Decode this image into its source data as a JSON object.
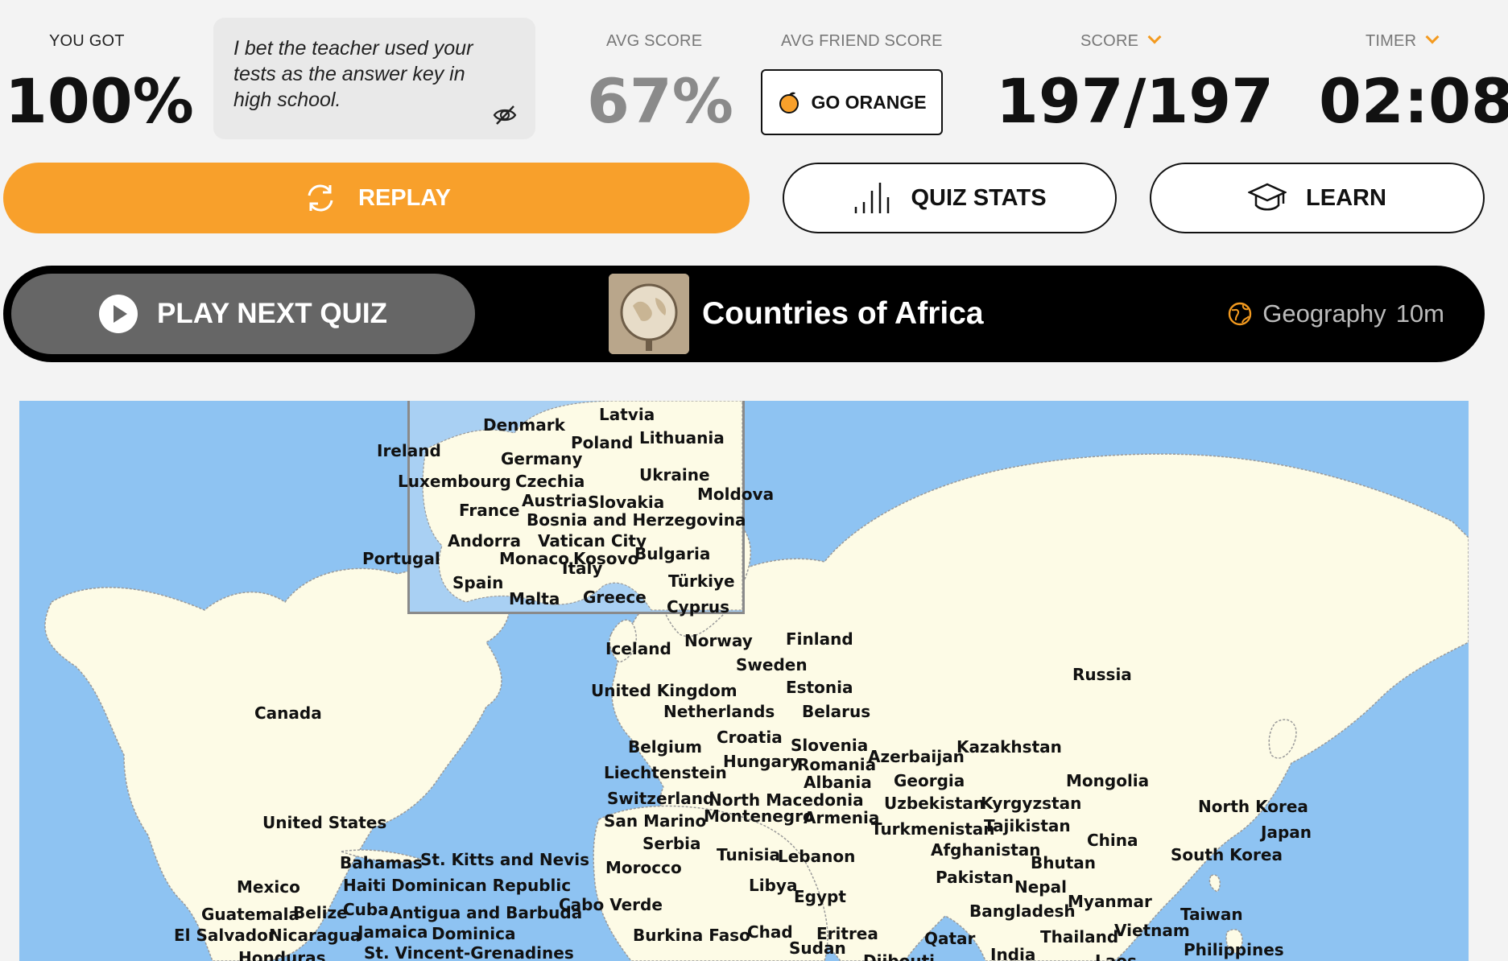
{
  "result": {
    "you_got_label": "YOU GOT",
    "you_got_value": "100%",
    "comment": "I bet the teacher used your tests as the answer key in high school.",
    "avg_score_label": "AVG SCORE",
    "avg_score_value": "67%",
    "avg_friend_label": "AVG FRIEND SCORE",
    "go_orange_label": "GO ORANGE",
    "score_label": "SCORE",
    "score_value": "197/197",
    "timer_label": "TIMER",
    "timer_value": "02:08"
  },
  "actions": {
    "replay": "REPLAY",
    "quiz_stats": "QUIZ STATS",
    "learn": "LEARN"
  },
  "next_quiz": {
    "button": "PLAY NEXT QUIZ",
    "title": "Countries of Africa",
    "category": "Geography",
    "duration": "10m"
  },
  "colors": {
    "accent": "#f8a02b",
    "ocean": "#8ec3f2",
    "land": "#fdfbe6"
  },
  "map": {
    "labels": [
      {
        "text": "Denmark"
      },
      {
        "text": "Latvia"
      },
      {
        "text": "Lithuania"
      },
      {
        "text": "Poland"
      },
      {
        "text": "Ireland"
      },
      {
        "text": "Germany"
      },
      {
        "text": "Luxembourg"
      },
      {
        "text": "Czechia"
      },
      {
        "text": "Ukraine"
      },
      {
        "text": "France"
      },
      {
        "text": "Austria"
      },
      {
        "text": "Slovakia"
      },
      {
        "text": "Moldova"
      },
      {
        "text": "Bosnia and Herzegovina"
      },
      {
        "text": "Andorra"
      },
      {
        "text": "Vatican City"
      },
      {
        "text": "Portugal"
      },
      {
        "text": "Monaco"
      },
      {
        "text": "Kosovo"
      },
      {
        "text": "Bulgaria"
      },
      {
        "text": "Italy"
      },
      {
        "text": "Spain"
      },
      {
        "text": "Türkiye"
      },
      {
        "text": "Malta"
      },
      {
        "text": "Greece"
      },
      {
        "text": "Cyprus"
      },
      {
        "text": "Iceland"
      },
      {
        "text": "Norway"
      },
      {
        "text": "Finland"
      },
      {
        "text": "Sweden"
      },
      {
        "text": "Russia"
      },
      {
        "text": "United Kingdom"
      },
      {
        "text": "Estonia"
      },
      {
        "text": "Canada"
      },
      {
        "text": "Netherlands"
      },
      {
        "text": "Belarus"
      },
      {
        "text": "Belgium"
      },
      {
        "text": "Croatia"
      },
      {
        "text": "Slovenia"
      },
      {
        "text": "Azerbaijan"
      },
      {
        "text": "Kazakhstan"
      },
      {
        "text": "Hungary"
      },
      {
        "text": "Romania"
      },
      {
        "text": "Liechtenstein"
      },
      {
        "text": "Albania"
      },
      {
        "text": "Georgia"
      },
      {
        "text": "Mongolia"
      },
      {
        "text": "Switzerland"
      },
      {
        "text": "North Macedonia"
      },
      {
        "text": "Uzbekistan"
      },
      {
        "text": "Kyrgyzstan"
      },
      {
        "text": "North Korea"
      },
      {
        "text": "United States"
      },
      {
        "text": "San Marino"
      },
      {
        "text": "Montenegro"
      },
      {
        "text": "Armenia"
      },
      {
        "text": "Turkmenistan"
      },
      {
        "text": "Tajikistan"
      },
      {
        "text": "Japan"
      },
      {
        "text": "Serbia"
      },
      {
        "text": "China"
      },
      {
        "text": "Afghanistan"
      },
      {
        "text": "Tunisia"
      },
      {
        "text": "Lebanon"
      },
      {
        "text": "Bahamas"
      },
      {
        "text": "St. Kitts and Nevis"
      },
      {
        "text": "Bhutan"
      },
      {
        "text": "South Korea"
      },
      {
        "text": "Morocco"
      },
      {
        "text": "Pakistan"
      },
      {
        "text": "Mexico"
      },
      {
        "text": "Haiti"
      },
      {
        "text": "Dominican Republic"
      },
      {
        "text": "Libya"
      },
      {
        "text": "Nepal"
      },
      {
        "text": "Egypt"
      },
      {
        "text": "Myanmar"
      },
      {
        "text": "Cabo Verde"
      },
      {
        "text": "Guatemala"
      },
      {
        "text": "Belize"
      },
      {
        "text": "Cuba"
      },
      {
        "text": "Antigua and Barbuda"
      },
      {
        "text": "Bangladesh"
      },
      {
        "text": "Taiwan"
      },
      {
        "text": "El Salvador"
      },
      {
        "text": "Nicaragua"
      },
      {
        "text": "Jamaica"
      },
      {
        "text": "Dominica"
      },
      {
        "text": "Burkina Faso"
      },
      {
        "text": "Chad"
      },
      {
        "text": "Eritrea"
      },
      {
        "text": "Qatar"
      },
      {
        "text": "Thailand"
      },
      {
        "text": "Vietnam"
      },
      {
        "text": "Sudan"
      },
      {
        "text": "Philippines"
      },
      {
        "text": "Honduras"
      },
      {
        "text": "St. Vincent-Grenadines"
      },
      {
        "text": "Djibouti"
      },
      {
        "text": "India"
      },
      {
        "text": "Laos"
      }
    ]
  }
}
